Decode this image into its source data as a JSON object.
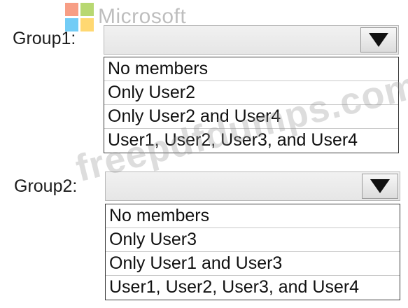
{
  "logo": {
    "text": "Microsoft",
    "colors": [
      "#f25022",
      "#7fba00",
      "#00a4ef",
      "#ffb900"
    ]
  },
  "watermark": "freepdfdumps.com",
  "groups": [
    {
      "label": "Group1:",
      "selected": "",
      "dropdown_icon": "caret-down-icon",
      "options": [
        "No members",
        "Only User2",
        "Only User2 and User4",
        "User1, User2, User3, and User4"
      ]
    },
    {
      "label": "Group2:",
      "selected": "",
      "dropdown_icon": "caret-down-icon",
      "options": [
        "No members",
        "Only User3",
        "Only User1 and User3",
        "User1, User2, User3, and User4"
      ]
    }
  ]
}
